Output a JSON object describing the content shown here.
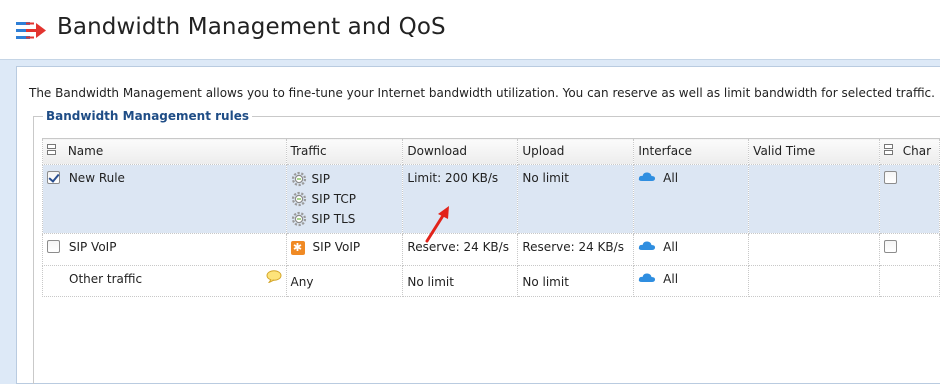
{
  "page": {
    "title": "Bandwidth Management and QoS",
    "intro": "The Bandwidth Management allows you to fine-tune your Internet bandwidth utilization. You can reserve as well as limit bandwidth for selected traffic.",
    "section_title": "Bandwidth Management rules"
  },
  "table": {
    "columns": [
      "Name",
      "Traffic",
      "Download",
      "Upload",
      "Interface",
      "Valid Time",
      "Char"
    ],
    "rows": [
      {
        "name": "New Rule",
        "checked": true,
        "traffic": [
          "SIP",
          "SIP TCP",
          "SIP TLS"
        ],
        "download": "Limit: 200 KB/s",
        "upload": "No limit",
        "interface": "All",
        "valid_time": ""
      },
      {
        "name": "SIP VoIP",
        "checked": false,
        "traffic": [
          "SIP VoIP"
        ],
        "download": "Reserve: 24 KB/s",
        "upload": "Reserve: 24 KB/s",
        "interface": "All",
        "valid_time": ""
      },
      {
        "name": "Other traffic",
        "traffic": [
          "Any"
        ],
        "download": "No limit",
        "upload": "No limit",
        "interface": "All",
        "valid_time": ""
      }
    ]
  },
  "icons": {
    "header": "bandwidth-logo-icon",
    "traffic_service": "service-gear-icon",
    "voip": "voip-service-icon",
    "interface": "cloud-icon",
    "comment": "comment-icon",
    "annotation": "red-arrow-annotation"
  },
  "colors": {
    "accent_blue": "#2f7fd6",
    "logo_red": "#e3342f",
    "legend_blue": "#1f4d86",
    "selected_row": "#dce6f3",
    "band": "#dde9f7"
  }
}
